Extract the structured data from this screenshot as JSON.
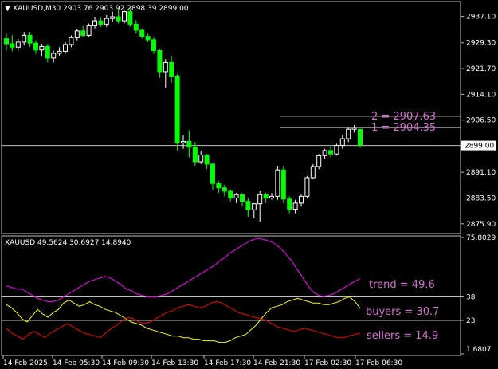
{
  "header": {
    "symbol_info": "XAUUSD,M30  2903.76 2903.92 2898.39 2899.00"
  },
  "price_scale": {
    "ticks": [
      "2937.10",
      "2929.30",
      "2921.70",
      "2914.10",
      "2906.50",
      "2899.00",
      "2891.10",
      "2883.50",
      "2875.90"
    ],
    "current_price": "2899.00"
  },
  "price_levels": [
    {
      "label": "2 = 2907.63",
      "value": 2907.63
    },
    {
      "label": "1 = 2904.35",
      "value": 2904.35
    }
  ],
  "indicator": {
    "header": "XAUUSD 49.5624 30.6927 14.8940",
    "scale_ticks": [
      "75.8029",
      "38",
      "23",
      "1.6807"
    ],
    "levels": [
      38,
      23
    ],
    "labels": [
      {
        "text": "trend = 49.6",
        "color": "#da70d6"
      },
      {
        "text": "buyers = 30.7",
        "color": "#da70d6"
      },
      {
        "text": "sellers = 14.9",
        "color": "#da70d6"
      }
    ]
  },
  "time_axis": [
    "14 Feb 2025",
    "14 Feb 05:30",
    "14 Feb 09:30",
    "14 Feb 13:30",
    "14 Feb 17:30",
    "14 Feb 21:30",
    "17 Feb 02:30",
    "17 Feb 06:30"
  ],
  "colors": {
    "background": "#000000",
    "bull_candle": "#ffffff",
    "bear_candle": "#00ff00",
    "trend_line": "#ff00ff",
    "buyers_line": "#ffff00",
    "sellers_line": "#ff0000",
    "level_line": "#c0c0c0",
    "label_text": "#da70d6",
    "axis_text": "#ffffff"
  },
  "chart_data": {
    "type": "candlestick",
    "price_range": [
      2873.5,
      2941.0
    ],
    "candles": [
      {
        "o": 2930.5,
        "h": 2932.0,
        "l": 2927.0,
        "c": 2929.0
      },
      {
        "o": 2929.0,
        "h": 2931.5,
        "l": 2926.8,
        "c": 2928.0
      },
      {
        "o": 2928.0,
        "h": 2930.5,
        "l": 2927.0,
        "c": 2929.5
      },
      {
        "o": 2929.5,
        "h": 2932.5,
        "l": 2928.5,
        "c": 2931.5
      },
      {
        "o": 2931.5,
        "h": 2932.5,
        "l": 2928.0,
        "c": 2929.2
      },
      {
        "o": 2929.2,
        "h": 2930.0,
        "l": 2926.0,
        "c": 2927.2
      },
      {
        "o": 2927.2,
        "h": 2929.0,
        "l": 2925.5,
        "c": 2928.2
      },
      {
        "o": 2928.2,
        "h": 2929.0,
        "l": 2923.5,
        "c": 2924.8
      },
      {
        "o": 2924.8,
        "h": 2927.0,
        "l": 2923.5,
        "c": 2926.2
      },
      {
        "o": 2926.2,
        "h": 2928.0,
        "l": 2925.5,
        "c": 2926.8
      },
      {
        "o": 2926.8,
        "h": 2929.5,
        "l": 2926.0,
        "c": 2928.8
      },
      {
        "o": 2928.8,
        "h": 2931.5,
        "l": 2928.0,
        "c": 2930.8
      },
      {
        "o": 2930.8,
        "h": 2933.5,
        "l": 2930.0,
        "c": 2932.8
      },
      {
        "o": 2932.8,
        "h": 2934.5,
        "l": 2931.0,
        "c": 2931.5
      },
      {
        "o": 2931.5,
        "h": 2935.0,
        "l": 2931.0,
        "c": 2934.5
      },
      {
        "o": 2934.5,
        "h": 2937.0,
        "l": 2933.5,
        "c": 2935.8
      },
      {
        "o": 2935.8,
        "h": 2937.0,
        "l": 2934.0,
        "c": 2934.8
      },
      {
        "o": 2934.8,
        "h": 2937.5,
        "l": 2934.0,
        "c": 2936.5
      },
      {
        "o": 2936.5,
        "h": 2938.5,
        "l": 2935.5,
        "c": 2937.0
      },
      {
        "o": 2937.0,
        "h": 2939.5,
        "l": 2935.0,
        "c": 2935.8
      },
      {
        "o": 2935.8,
        "h": 2939.0,
        "l": 2935.0,
        "c": 2938.5
      },
      {
        "o": 2938.5,
        "h": 2939.5,
        "l": 2934.0,
        "c": 2934.8
      },
      {
        "o": 2934.8,
        "h": 2936.0,
        "l": 2932.0,
        "c": 2933.0
      },
      {
        "o": 2933.0,
        "h": 2933.5,
        "l": 2930.5,
        "c": 2931.2
      },
      {
        "o": 2931.2,
        "h": 2932.0,
        "l": 2929.5,
        "c": 2930.2
      },
      {
        "o": 2930.2,
        "h": 2931.0,
        "l": 2926.0,
        "c": 2927.0
      },
      {
        "o": 2927.0,
        "h": 2927.5,
        "l": 2919.0,
        "c": 2920.8
      },
      {
        "o": 2920.8,
        "h": 2924.5,
        "l": 2916.0,
        "c": 2923.5
      },
      {
        "o": 2923.5,
        "h": 2925.5,
        "l": 2917.5,
        "c": 2919.5
      },
      {
        "o": 2919.5,
        "h": 2920.0,
        "l": 2897.5,
        "c": 2899.8
      },
      {
        "o": 2899.8,
        "h": 2902.0,
        "l": 2898.0,
        "c": 2900.2
      },
      {
        "o": 2900.2,
        "h": 2903.5,
        "l": 2895.5,
        "c": 2898.5
      },
      {
        "o": 2898.5,
        "h": 2900.0,
        "l": 2893.0,
        "c": 2894.2
      },
      {
        "o": 2894.2,
        "h": 2897.5,
        "l": 2893.5,
        "c": 2896.2
      },
      {
        "o": 2896.2,
        "h": 2896.5,
        "l": 2892.0,
        "c": 2893.5
      },
      {
        "o": 2893.5,
        "h": 2894.0,
        "l": 2886.0,
        "c": 2887.8
      },
      {
        "o": 2887.8,
        "h": 2888.5,
        "l": 2885.0,
        "c": 2886.5
      },
      {
        "o": 2886.5,
        "h": 2887.5,
        "l": 2884.0,
        "c": 2885.5
      },
      {
        "o": 2885.5,
        "h": 2886.0,
        "l": 2882.5,
        "c": 2883.5
      },
      {
        "o": 2883.5,
        "h": 2885.0,
        "l": 2882.0,
        "c": 2884.5
      },
      {
        "o": 2884.5,
        "h": 2885.0,
        "l": 2881.0,
        "c": 2882.5
      },
      {
        "o": 2882.5,
        "h": 2883.5,
        "l": 2878.0,
        "c": 2880.0
      },
      {
        "o": 2880.0,
        "h": 2882.0,
        "l": 2877.5,
        "c": 2881.8
      },
      {
        "o": 2881.8,
        "h": 2885.5,
        "l": 2876.5,
        "c": 2884.5
      },
      {
        "o": 2884.5,
        "h": 2885.0,
        "l": 2882.0,
        "c": 2883.5
      },
      {
        "o": 2883.5,
        "h": 2885.0,
        "l": 2883.0,
        "c": 2884.0
      },
      {
        "o": 2884.0,
        "h": 2893.0,
        "l": 2883.0,
        "c": 2891.8
      },
      {
        "o": 2891.8,
        "h": 2893.0,
        "l": 2882.0,
        "c": 2883.2
      },
      {
        "o": 2883.2,
        "h": 2884.0,
        "l": 2879.0,
        "c": 2880.2
      },
      {
        "o": 2880.2,
        "h": 2883.0,
        "l": 2879.0,
        "c": 2882.0
      },
      {
        "o": 2882.0,
        "h": 2884.5,
        "l": 2881.0,
        "c": 2884.0
      },
      {
        "o": 2884.0,
        "h": 2890.0,
        "l": 2883.5,
        "c": 2889.5
      },
      {
        "o": 2889.5,
        "h": 2893.5,
        "l": 2889.0,
        "c": 2892.8
      },
      {
        "o": 2892.8,
        "h": 2896.5,
        "l": 2892.0,
        "c": 2896.0
      },
      {
        "o": 2896.0,
        "h": 2898.0,
        "l": 2895.0,
        "c": 2897.5
      },
      {
        "o": 2897.5,
        "h": 2899.0,
        "l": 2895.5,
        "c": 2896.5
      },
      {
        "o": 2896.5,
        "h": 2899.5,
        "l": 2896.0,
        "c": 2899.0
      },
      {
        "o": 2899.0,
        "h": 2902.0,
        "l": 2898.0,
        "c": 2901.0
      },
      {
        "o": 2901.0,
        "h": 2904.5,
        "l": 2900.0,
        "c": 2903.8
      },
      {
        "o": 2903.8,
        "h": 2905.0,
        "l": 2902.8,
        "c": 2904.2
      },
      {
        "o": 2903.76,
        "h": 2903.92,
        "l": 2898.39,
        "c": 2899.0
      }
    ],
    "indicator_range": [
      1.6807,
      75.8029
    ],
    "trend": [
      45,
      44,
      43,
      43,
      41,
      39,
      37,
      36,
      35,
      35,
      36,
      38,
      40,
      42,
      44,
      46,
      48,
      49,
      50,
      51,
      50,
      48,
      46,
      43,
      42,
      40,
      39,
      38,
      38,
      38,
      39,
      40,
      42,
      44,
      46,
      48,
      50,
      52,
      54,
      56,
      58,
      61,
      63,
      66,
      68,
      70,
      72,
      74,
      75,
      75,
      74,
      73,
      71,
      68,
      64,
      60,
      55,
      50,
      45,
      41,
      39,
      38,
      39,
      40,
      42,
      44,
      46,
      48,
      49.6
    ],
    "buyers": [
      33,
      31,
      28,
      24,
      22,
      26,
      30,
      27,
      25,
      28,
      30,
      34,
      36,
      34,
      32,
      33,
      35,
      33,
      32,
      30,
      29,
      28,
      26,
      24,
      22,
      21,
      20,
      18,
      17,
      16,
      15,
      14,
      13,
      13,
      12,
      12,
      11,
      11,
      10,
      10,
      10,
      9,
      9,
      10,
      12,
      13,
      14,
      17,
      20,
      24,
      28,
      31,
      32,
      33,
      35,
      36,
      37,
      36,
      35,
      34,
      34,
      33,
      33,
      34,
      35,
      37,
      38,
      35,
      30.7
    ],
    "sellers": [
      18,
      15,
      13,
      11,
      14,
      16,
      14,
      12,
      15,
      17,
      19,
      21,
      19,
      17,
      15,
      14,
      13,
      12,
      15,
      18,
      20,
      23,
      25,
      24,
      22,
      21,
      22,
      24,
      26,
      28,
      29,
      31,
      32,
      33,
      32,
      31,
      32,
      34,
      35,
      34,
      32,
      30,
      28,
      27,
      26,
      25,
      24,
      23,
      21,
      19,
      18,
      17,
      16,
      17,
      18,
      17,
      16,
      15,
      14,
      13,
      12,
      12,
      13,
      14,
      14.9
    ]
  }
}
